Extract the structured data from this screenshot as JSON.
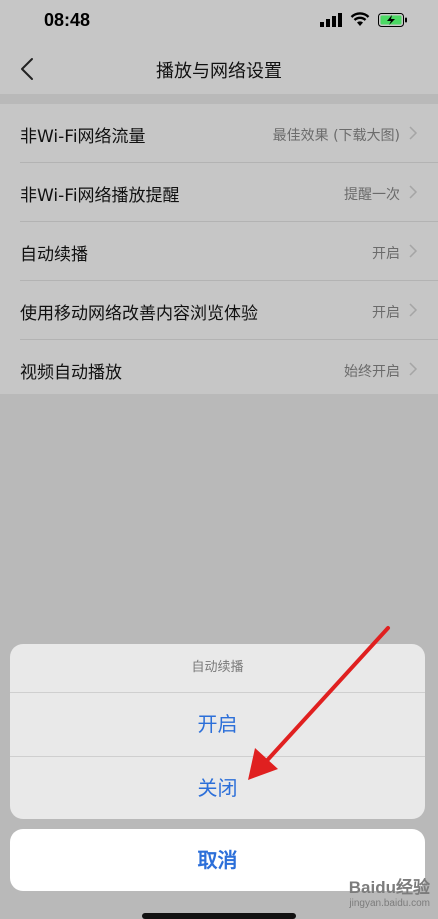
{
  "status_bar": {
    "time": "08:48"
  },
  "nav": {
    "title": "播放与网络设置"
  },
  "settings": [
    {
      "label": "非Wi-Fi网络流量",
      "value": "最佳效果 (下载大图)"
    },
    {
      "label": "非Wi-Fi网络播放提醒",
      "value": "提醒一次"
    },
    {
      "label": "自动续播",
      "value": "开启"
    },
    {
      "label": "使用移动网络改善内容浏览体验",
      "value": "开启"
    },
    {
      "label": "视频自动播放",
      "value": "始终开启"
    }
  ],
  "action_sheet": {
    "title": "自动续播",
    "options": [
      "开启",
      "关闭"
    ],
    "cancel": "取消"
  },
  "colors": {
    "accent": "#2c6fd9",
    "annotation_arrow": "#e02020"
  },
  "watermark": {
    "logo": "Baidu经验",
    "url": "jingyan.baidu.com"
  }
}
